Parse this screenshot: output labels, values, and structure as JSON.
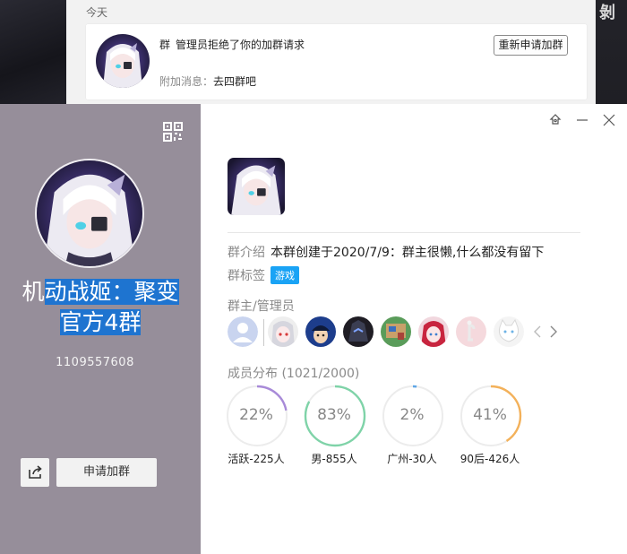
{
  "notification": {
    "day_label": "今天",
    "group_word": "群",
    "message": "管理员拒绝了你的加群请求",
    "reapply_label": "重新申请加群",
    "extra_label": "附加消息：",
    "extra_value": "去四群吧"
  },
  "background": {
    "corner_text": "剝"
  },
  "group": {
    "name_line1_prefix": "机",
    "name_line1_selected": "动战姬：聚变",
    "name_line2": "官方4群",
    "id": "1109557608",
    "apply_label": "申请加群"
  },
  "info": {
    "intro_label": "群介绍",
    "intro_value": "本群创建于2020/7/9：群主很懒,什么都没有留下",
    "tag_label": "群标签",
    "tag_value": "游戏"
  },
  "admins": {
    "title": "群主/管理员",
    "avatars": [
      "default-user-icon",
      "silver-hair-avatar",
      "blue-cap-avatar",
      "dark-mech-avatar",
      "pixel-art-avatar",
      "red-hair-avatar",
      "pink-doll-avatar",
      "white-cat-avatar"
    ]
  },
  "distribution": {
    "title": "成员分布 (1021/2000)",
    "stats": [
      {
        "percent": "22%",
        "fraction": 0.22,
        "label": "活跃-225人",
        "color": "#a88ad8"
      },
      {
        "percent": "83%",
        "fraction": 0.83,
        "label": "男-855人",
        "color": "#7fd3a8"
      },
      {
        "percent": "2%",
        "fraction": 0.02,
        "label": "广州-30人",
        "color": "#5fa6e6"
      },
      {
        "percent": "41%",
        "fraction": 0.41,
        "label": "90后-426人",
        "color": "#f3b15a"
      }
    ]
  },
  "colors": {
    "left_pane": "#968e9a",
    "selection": "#1e74d0",
    "tag_chip": "#1aa3f5"
  }
}
